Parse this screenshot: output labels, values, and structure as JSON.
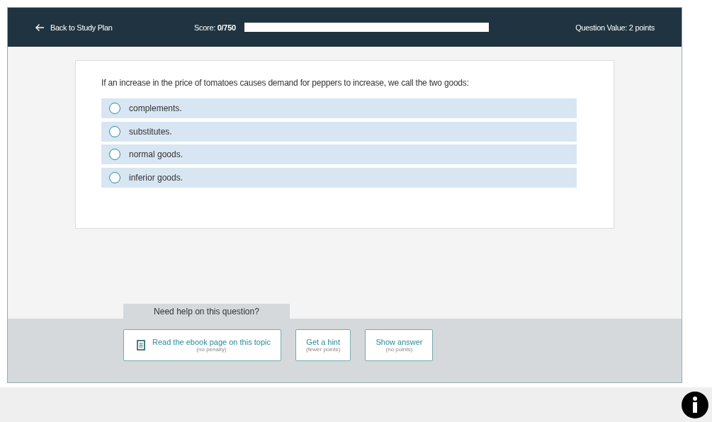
{
  "header": {
    "back_link": "Back to Study Plan",
    "score_label": "Score:",
    "score_value": "0/750",
    "score_progress": {
      "level": 0
    },
    "question_value": "Question Value: 2 points"
  },
  "question": {
    "prompt": "If an increase in the price of tomatoes causes demand for peppers to increase, we call the two goods:",
    "options": [
      {
        "label": "complements.",
        "selected": false
      },
      {
        "label": "substitutes.",
        "selected": false
      },
      {
        "label": "normal goods.",
        "selected": false
      },
      {
        "label": "inferior goods.",
        "selected": false
      }
    ]
  },
  "help": {
    "title": "Need help on this question?",
    "buttons": [
      {
        "kind": "ebook",
        "label": "Read the ebook page on this topic",
        "note": "(no penalty)"
      },
      {
        "kind": "plain",
        "label": "Get a hint",
        "note": "(fewer points)"
      },
      {
        "kind": "plain",
        "label": "Show answer",
        "note": "(no points)"
      }
    ]
  }
}
